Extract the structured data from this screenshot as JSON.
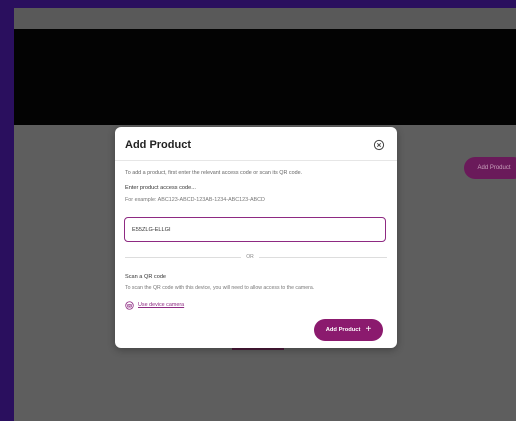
{
  "background_page": {
    "add_product_button_label": "Add Product"
  },
  "modal": {
    "title": "Add Product",
    "close_icon": "close-circle-icon",
    "intro_text": "To add a product, first enter the relevant access code or scan its QR code.",
    "access_code": {
      "label": "Enter product access code...",
      "example": "For example: ABC123-ABCD-123AB-1234-ABC123-ABCD",
      "value": "E55ZLG-ELLGI",
      "placeholder": ""
    },
    "separator_text": "OR",
    "qr": {
      "label": "Scan a QR code",
      "description": "To scan the QR code with this device, you will need to allow access to the camera.",
      "camera_link_label": "Use device camera",
      "camera_icon": "camera-icon"
    },
    "submit_button": {
      "label": "Add Product",
      "icon": "plus-icon"
    }
  },
  "colors": {
    "accent": "#8b1a6e",
    "input_border": "#8e2a82",
    "outer_background": "#2a0f5e",
    "overlay": "#5a5a5a"
  }
}
